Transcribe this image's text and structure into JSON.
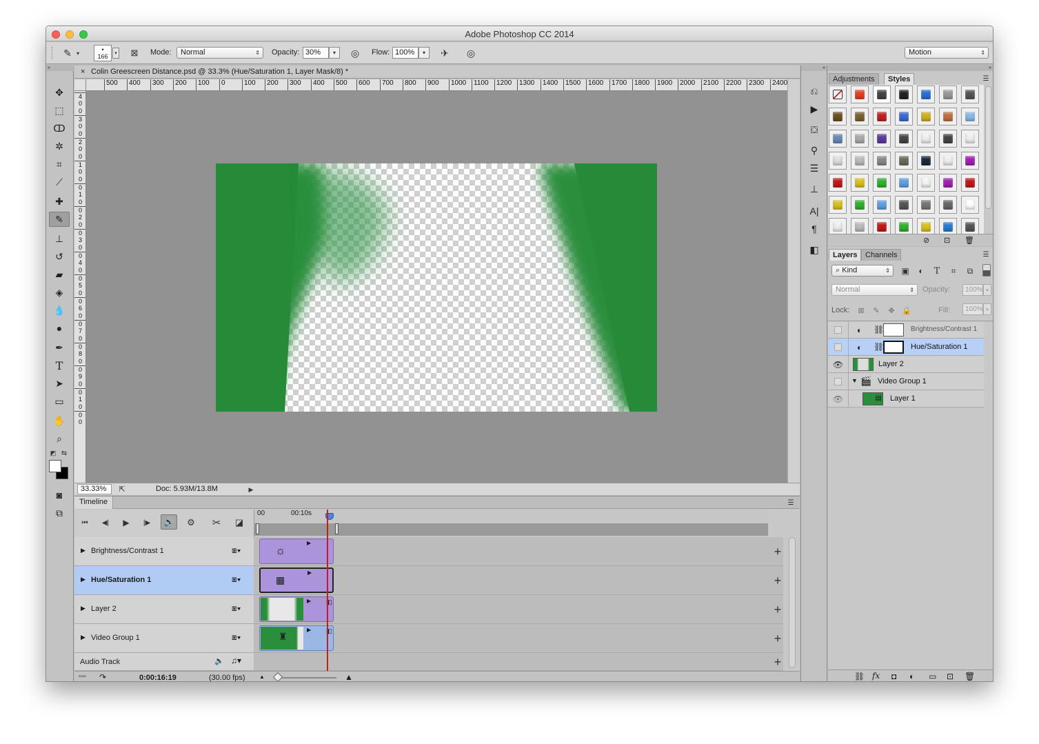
{
  "window": {
    "title": "Adobe Photoshop CC 2014"
  },
  "options_bar": {
    "brush_size": "166",
    "mode_label": "Mode:",
    "mode_value": "Normal",
    "opacity_label": "Opacity:",
    "opacity_value": "30%",
    "flow_label": "Flow:",
    "flow_value": "100%",
    "workspace": "Motion"
  },
  "document": {
    "tab_title": "Colin Greescreen Distance.psd @ 33.3% (Hue/Saturation 1, Layer Mask/8) *",
    "zoom": "33.33%",
    "doc_info": "Doc: 5.93M/13.8M"
  },
  "rulers": {
    "horizontal": [
      "500",
      "400",
      "300",
      "200",
      "100",
      "0",
      "100",
      "200",
      "300",
      "400",
      "500",
      "600",
      "700",
      "800",
      "900",
      "1000",
      "1100",
      "1200",
      "1300",
      "1400",
      "1500",
      "1600",
      "1700",
      "1800",
      "1900",
      "2000",
      "2100",
      "2200",
      "2300",
      "2400"
    ],
    "vertical": [
      "4",
      "0",
      "0",
      "3",
      "0",
      "0",
      "2",
      "0",
      "0",
      "1",
      "0",
      "0",
      "0",
      "1",
      "0",
      "0",
      "2",
      "0",
      "0",
      "3",
      "0",
      "0",
      "4",
      "0",
      "0",
      "5",
      "0",
      "0",
      "6",
      "0",
      "0",
      "7",
      "0",
      "0",
      "8",
      "0",
      "0",
      "9",
      "0",
      "0",
      "1",
      "0",
      "0",
      "0"
    ]
  },
  "timeline": {
    "title": "Timeline",
    "time_marks": [
      "00",
      "00:10s"
    ],
    "tracks": [
      {
        "name": "Brightness/Contrast 1",
        "selected": false
      },
      {
        "name": "Hue/Saturation 1",
        "selected": true
      },
      {
        "name": "Layer 2",
        "selected": false
      },
      {
        "name": "Video Group 1",
        "selected": false
      }
    ],
    "audio_track": "Audio Track",
    "current_time": "0:00:16:19",
    "fps": "(30.00 fps)"
  },
  "panels": {
    "adjustments_tab": "Adjustments",
    "styles_tab": "Styles",
    "layers_tab": "Layers",
    "channels_tab": "Channels",
    "filter_kind": "Kind",
    "blend_mode": "Normal",
    "opacity_label": "Opacity:",
    "opacity_value": "100%",
    "lock_label": "Lock:",
    "fill_label": "Fill:",
    "fill_value": "100%"
  },
  "layers": [
    {
      "name": "Brightness/Contrast 1",
      "visible": false,
      "selected": false
    },
    {
      "name": "Hue/Saturation 1",
      "visible": false,
      "selected": true
    },
    {
      "name": "Layer 2",
      "visible": true,
      "selected": false
    },
    {
      "name": "Video Group 1",
      "visible": false,
      "selected": false
    },
    {
      "name": "Layer 1",
      "visible": true,
      "selected": false
    }
  ],
  "colors": {
    "green_screen": "#2a8e3c",
    "selection_blue": "#b2cbf5",
    "clip_purple": "#ac94db",
    "playhead_red": "#d01818"
  }
}
